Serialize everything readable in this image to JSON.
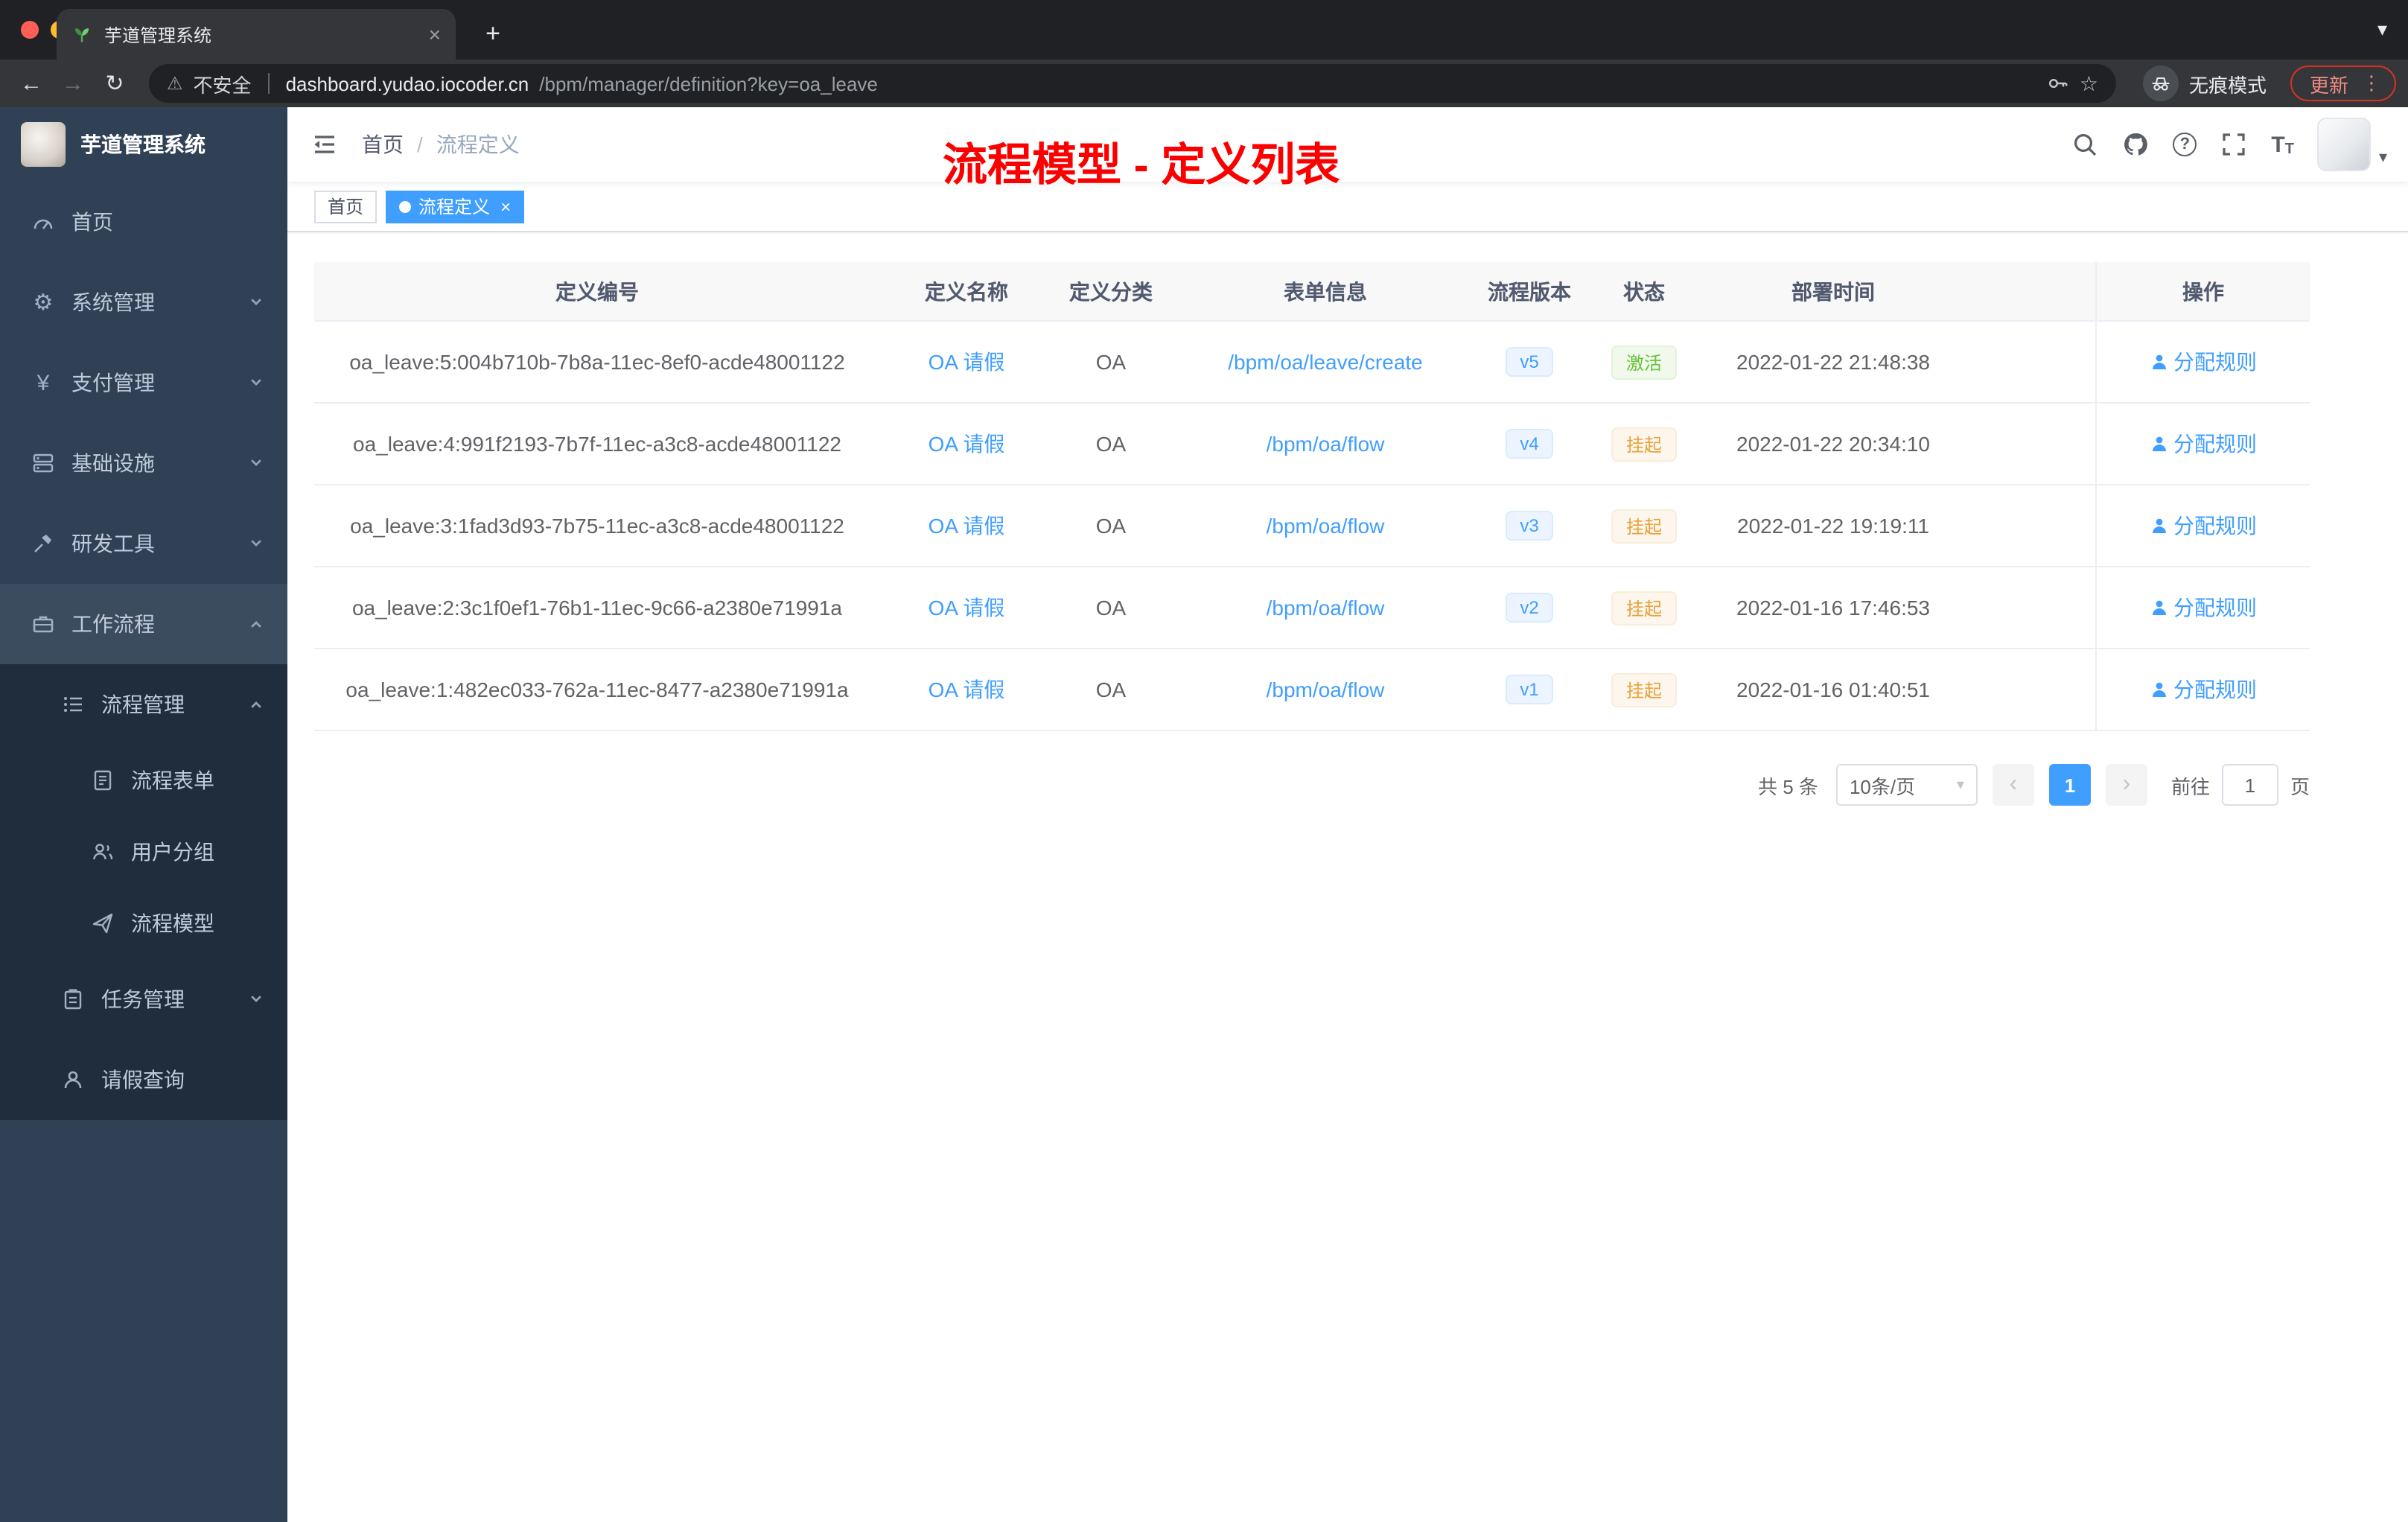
{
  "colors": {
    "accent": "#409eff",
    "success": "#67c23a",
    "warning": "#e6a23c",
    "annotation_red": "#fb0000",
    "sidebar_bg": "#304156",
    "submenu_bg": "#1f2d3d"
  },
  "icons": {
    "back": "←",
    "forward": "→",
    "refresh": "↻",
    "warning": "⚠",
    "star": "☆",
    "kebab": "⋮",
    "caret_down": "▾",
    "close": "×",
    "plus": "+",
    "prev": "‹",
    "next": "›",
    "gear": "⚙",
    "yen": "¥",
    "question": "?",
    "font_size_big": "T",
    "font_size_small": "T"
  },
  "browser": {
    "tab_title": "芋道管理系统",
    "security_label": "不安全",
    "url_host": "dashboard.yudao.iocoder.cn",
    "url_path": "/bpm/manager/definition?key=oa_leave",
    "incognito_label": "无痕模式",
    "update_label": "更新"
  },
  "sidebar": {
    "logo_title": "芋道管理系统",
    "items": [
      {
        "label": "首页"
      },
      {
        "label": "系统管理"
      },
      {
        "label": "支付管理"
      },
      {
        "label": "基础设施"
      },
      {
        "label": "研发工具"
      },
      {
        "label": "工作流程"
      },
      {
        "label": "流程管理"
      },
      {
        "label": "流程表单"
      },
      {
        "label": "用户分组"
      },
      {
        "label": "流程模型"
      },
      {
        "label": "任务管理"
      },
      {
        "label": "请假查询"
      }
    ]
  },
  "header": {
    "breadcrumb_home": "首页",
    "breadcrumb_sep": "/",
    "breadcrumb_current": "流程定义",
    "annotation": "流程模型 - 定义列表"
  },
  "tags": {
    "home": "首页",
    "active": "流程定义"
  },
  "table": {
    "columns": [
      "定义编号",
      "定义名称",
      "定义分类",
      "表单信息",
      "流程版本",
      "状态",
      "部署时间",
      "操作"
    ],
    "rows": [
      {
        "id": "oa_leave:5:004b710b-7b8a-11ec-8ef0-acde48001122",
        "name": "OA 请假",
        "category": "OA",
        "form": "/bpm/oa/leave/create",
        "version": "v5",
        "status": "激活",
        "status_type": "success",
        "deploy_time": "2022-01-22 21:48:38",
        "action": "分配规则"
      },
      {
        "id": "oa_leave:4:991f2193-7b7f-11ec-a3c8-acde48001122",
        "name": "OA 请假",
        "category": "OA",
        "form": "/bpm/oa/flow",
        "version": "v4",
        "status": "挂起",
        "status_type": "warning",
        "deploy_time": "2022-01-22 20:34:10",
        "action": "分配规则"
      },
      {
        "id": "oa_leave:3:1fad3d93-7b75-11ec-a3c8-acde48001122",
        "name": "OA 请假",
        "category": "OA",
        "form": "/bpm/oa/flow",
        "version": "v3",
        "status": "挂起",
        "status_type": "warning",
        "deploy_time": "2022-01-22 19:19:11",
        "action": "分配规则"
      },
      {
        "id": "oa_leave:2:3c1f0ef1-76b1-11ec-9c66-a2380e71991a",
        "name": "OA 请假",
        "category": "OA",
        "form": "/bpm/oa/flow",
        "version": "v2",
        "status": "挂起",
        "status_type": "warning",
        "deploy_time": "2022-01-16 17:46:53",
        "action": "分配规则"
      },
      {
        "id": "oa_leave:1:482ec033-762a-11ec-8477-a2380e71991a",
        "name": "OA 请假",
        "category": "OA",
        "form": "/bpm/oa/flow",
        "version": "v1",
        "status": "挂起",
        "status_type": "warning",
        "deploy_time": "2022-01-16 01:40:51",
        "action": "分配规则"
      }
    ]
  },
  "pagination": {
    "total": "共 5 条",
    "page_size": "10条/页",
    "current_page": "1",
    "goto_label": "前往",
    "goto_value": "1",
    "unit": "页"
  }
}
